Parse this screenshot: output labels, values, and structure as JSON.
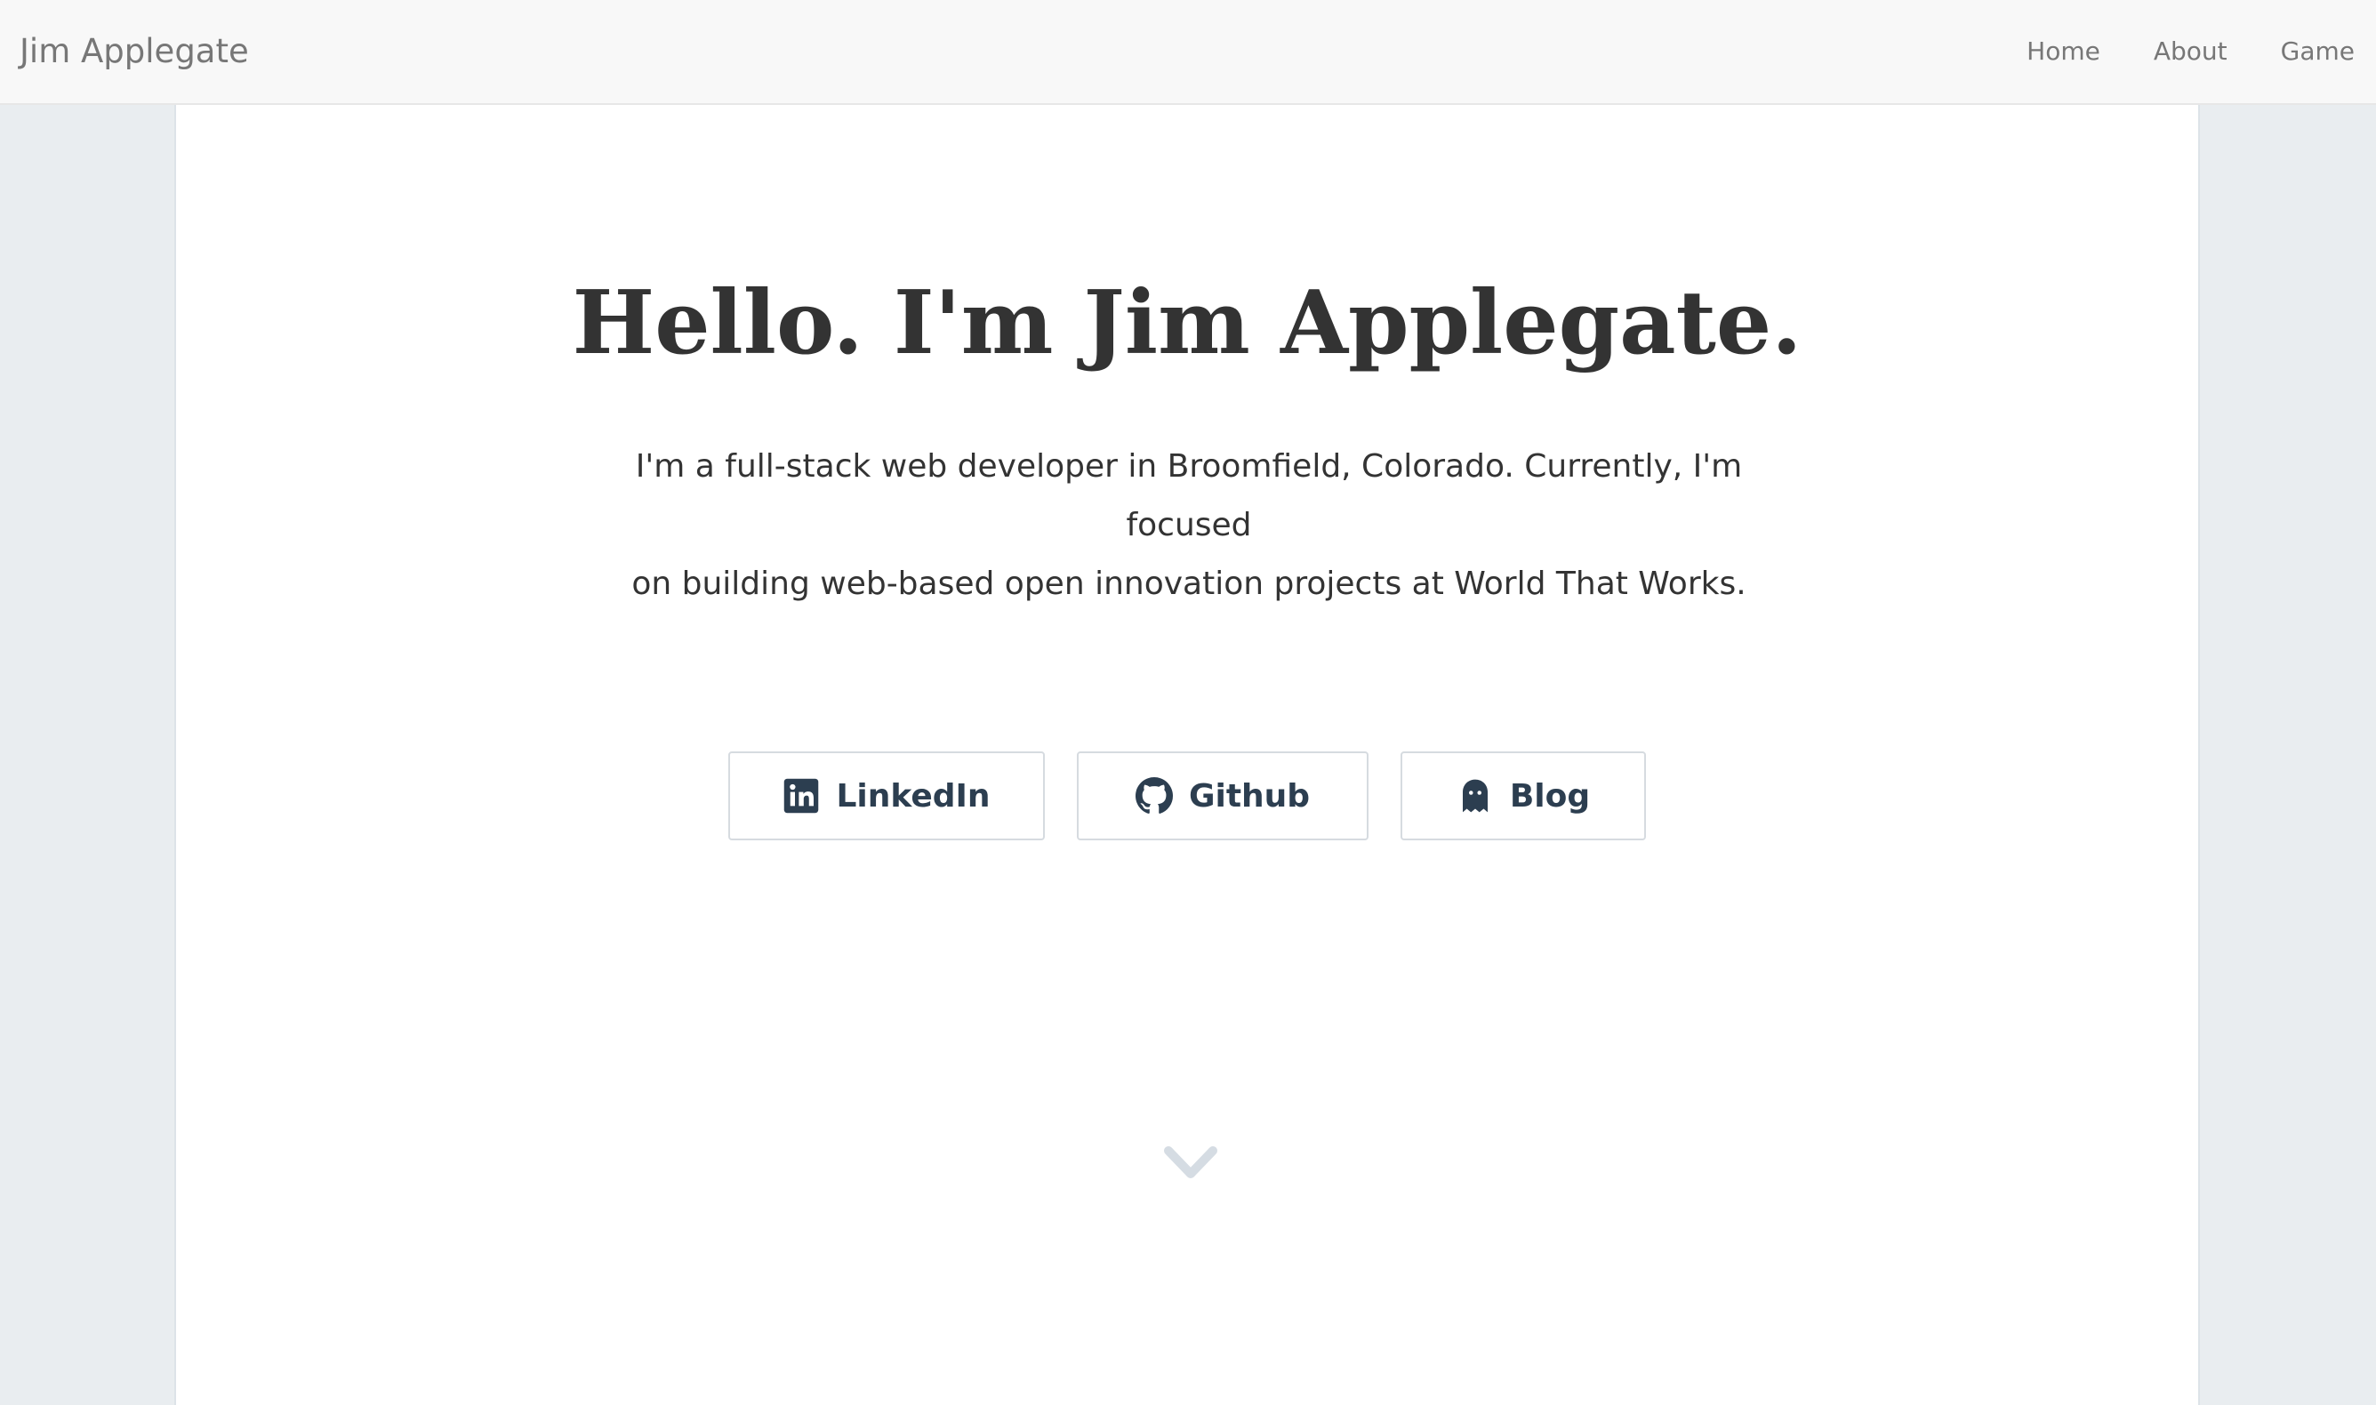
{
  "navbar": {
    "brand": "Jim Applegate",
    "links": [
      {
        "label": "Home"
      },
      {
        "label": "About"
      },
      {
        "label": "Game"
      }
    ]
  },
  "hero": {
    "title": "Hello. I'm Jim Applegate.",
    "intro_line_1": "I'm a full-stack web developer in Broomfield, Colorado. Currently, I'm focused",
    "intro_line_2": "on building web-based open innovation projects at World That Works."
  },
  "social_buttons": [
    {
      "label": "LinkedIn",
      "icon": "linkedin-icon"
    },
    {
      "label": "Github",
      "icon": "github-icon"
    },
    {
      "label": "Blog",
      "icon": "ghost-icon"
    }
  ],
  "scroll_indicator": {
    "icon": "chevron-down-icon"
  },
  "colors": {
    "page_background": "#e9edf0",
    "navbar_background": "#f8f8f8",
    "panel_background": "#ffffff",
    "heading_text": "#333333",
    "button_text": "#2c3e50",
    "nav_text": "#777777",
    "chevron": "#d5dce3"
  }
}
